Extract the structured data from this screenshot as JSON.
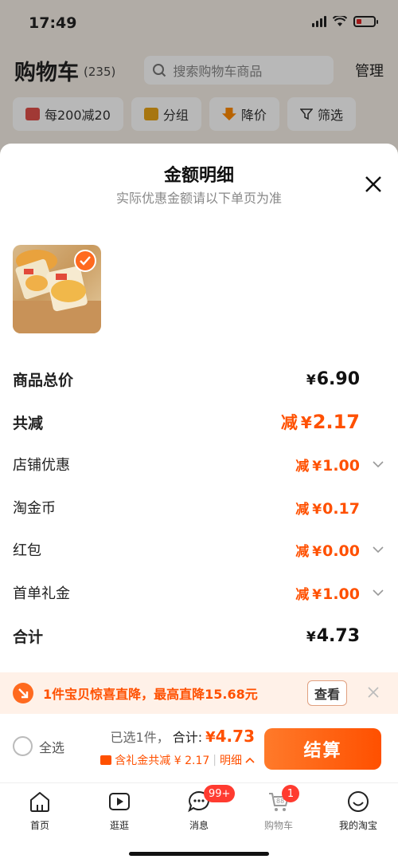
{
  "status": {
    "time": "17:49"
  },
  "cart": {
    "title": "购物车",
    "count": "(235)",
    "search_placeholder": "搜索购物车商品",
    "manage": "管理"
  },
  "filters": [
    {
      "label": "每200减20",
      "icon": "shop-icon",
      "color": "#e0504a"
    },
    {
      "label": "分组",
      "icon": "folder-icon",
      "color": "#e8a417"
    },
    {
      "label": "降价",
      "icon": "down-arrow-icon",
      "color": "#ff8a00"
    },
    {
      "label": "筛选",
      "icon": "funnel-icon",
      "color": "#333333"
    }
  ],
  "sheet": {
    "title": "金额明细",
    "subtitle": "实际优惠金额请以下单页为准",
    "rows": [
      {
        "label": "商品总价",
        "prefix": "",
        "currency": "¥",
        "value": "6.90",
        "bold": true,
        "orange": false,
        "chevron": false
      },
      {
        "label": "共减",
        "prefix": "减",
        "currency": "¥",
        "value": "2.17",
        "bold": true,
        "orange": true,
        "chevron": false
      },
      {
        "label": "店铺优惠",
        "prefix": "减",
        "currency": "¥",
        "value": "1.00",
        "bold": false,
        "orange": true,
        "chevron": true
      },
      {
        "label": "淘金币",
        "prefix": "减",
        "currency": "¥",
        "value": "0.17",
        "bold": false,
        "orange": true,
        "chevron": false
      },
      {
        "label": "红包",
        "prefix": "减",
        "currency": "¥",
        "value": "0.00",
        "bold": false,
        "orange": true,
        "chevron": true
      },
      {
        "label": "首单礼金",
        "prefix": "减",
        "currency": "¥",
        "value": "1.00",
        "bold": false,
        "orange": true,
        "chevron": true
      },
      {
        "label": "合计",
        "prefix": "",
        "currency": "¥",
        "value": "4.73",
        "bold": true,
        "orange": false,
        "chevron": false
      }
    ]
  },
  "promo": {
    "text": "1件宝贝惊喜直降，最高直降15.68元",
    "view": "查看"
  },
  "checkout": {
    "select_all": "全选",
    "selected": "已选1件，",
    "total_label": "合计:",
    "total_currency": "¥",
    "total_value": "4.73",
    "gift_text": "含礼金共减 ¥ 2.17",
    "detail": "明细",
    "pay": "结算"
  },
  "tabs": [
    {
      "label": "首页",
      "icon": "home-icon",
      "badge": ""
    },
    {
      "label": "逛逛",
      "icon": "play-icon",
      "badge": ""
    },
    {
      "label": "消息",
      "icon": "message-icon",
      "badge": "99+"
    },
    {
      "label": "购物车",
      "icon": "cart-icon",
      "badge": "1"
    },
    {
      "label": "我的淘宝",
      "icon": "smile-icon",
      "badge": ""
    }
  ],
  "colors": {
    "accent": "#ff5000",
    "badge": "#ff3b30"
  }
}
